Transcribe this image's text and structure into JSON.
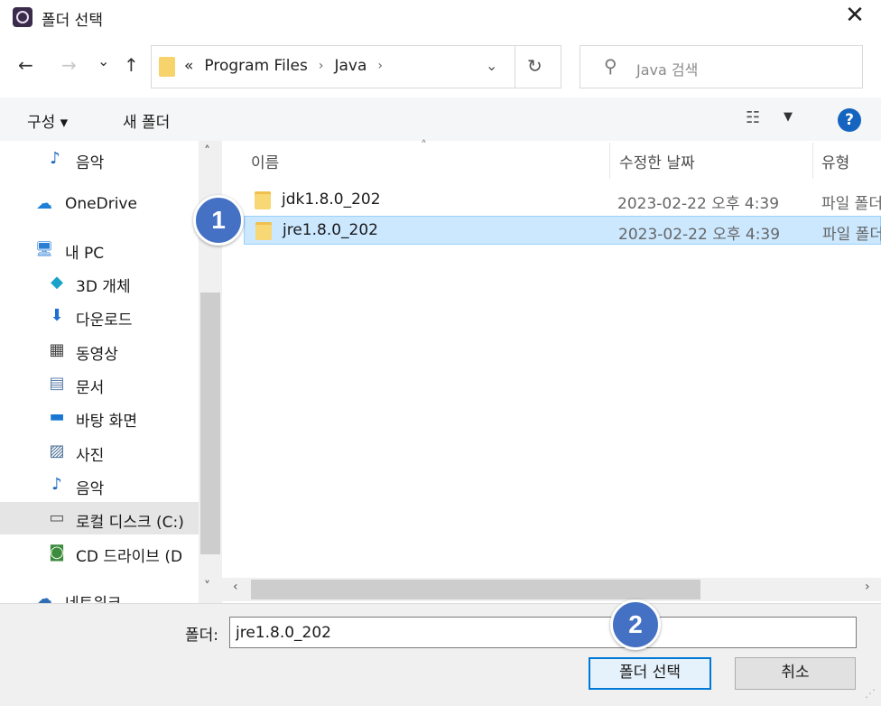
{
  "window": {
    "title": "폴더 선택",
    "close_glyph": "✕"
  },
  "nav": {
    "back_glyph": "←",
    "forward_glyph": "→",
    "recent_glyph": "⌄",
    "up_glyph": "↑",
    "breadcrumb_overflow": "«",
    "breadcrumbs": [
      "Program Files",
      "Java"
    ],
    "crumb_sep": "›",
    "dropdown_glyph": "⌄",
    "refresh_glyph": "↻"
  },
  "search": {
    "placeholder": "Java 검색",
    "icon_glyph": "⚲"
  },
  "toolbar": {
    "organize_label": "구성 ▾",
    "new_folder_label": "새 폴더",
    "view_glyph": "☷",
    "view_dd_glyph": "▼",
    "help_glyph": "?"
  },
  "sidebar": {
    "items": [
      {
        "label": "음악",
        "icon": "music-icon",
        "glyph": "♪",
        "color": "#1565c0"
      },
      {
        "label": "OneDrive",
        "icon": "cloud-icon",
        "glyph": "☁",
        "color": "#1e7fd6"
      },
      {
        "label": "내 PC",
        "icon": "computer-icon",
        "glyph": "🖥",
        "color": "#2a7fd4"
      },
      {
        "label": "3D 개체",
        "icon": "cube-icon",
        "glyph": "◆",
        "color": "#1aa3c8"
      },
      {
        "label": "다운로드",
        "icon": "download-icon",
        "glyph": "⬇",
        "color": "#1f6fd1"
      },
      {
        "label": "동영상",
        "icon": "film-icon",
        "glyph": "▦",
        "color": "#444444"
      },
      {
        "label": "문서",
        "icon": "document-icon",
        "glyph": "▤",
        "color": "#5a7ca8"
      },
      {
        "label": "바탕 화면",
        "icon": "desktop-icon",
        "glyph": "▬",
        "color": "#1976d2"
      },
      {
        "label": "사진",
        "icon": "picture-icon",
        "glyph": "▨",
        "color": "#4a6e96"
      },
      {
        "label": "음악",
        "icon": "music-icon",
        "glyph": "♪",
        "color": "#1565c0"
      },
      {
        "label": "로컬 디스크 (C:)",
        "icon": "drive-icon",
        "glyph": "▭",
        "color": "#555555"
      },
      {
        "label": "CD 드라이브 (D",
        "icon": "cd-drive-icon",
        "glyph": "◙",
        "color": "#3d8b3d"
      },
      {
        "label": "네트워크",
        "icon": "network-icon",
        "glyph": "☁",
        "color": "#2f6db5"
      }
    ],
    "scroll_up_glyph": "˄",
    "scroll_down_glyph": "˅"
  },
  "columns": {
    "name": "이름",
    "modified": "수정한 날짜",
    "type": "유형",
    "sort_glyph": "˄"
  },
  "files": [
    {
      "name": "jdk1.8.0_202",
      "modified": "2023-02-22 오후 4:39",
      "type": "파일 폴더"
    },
    {
      "name": "jre1.8.0_202",
      "modified": "2023-02-22 오후 4:39",
      "type": "파일 폴더"
    }
  ],
  "hscroll": {
    "left_glyph": "‹",
    "right_glyph": "›"
  },
  "footer": {
    "folder_label": "폴더:",
    "folder_value": "jre1.8.0_202",
    "select_button": "폴더 선택",
    "cancel_button": "취소",
    "grip_glyph": "⋰"
  },
  "markers": [
    "1",
    "2"
  ],
  "colors": {
    "accent": "#0078d7",
    "selection": "#cce8ff",
    "marker": "#4571c4",
    "folder": "#f8d775"
  }
}
